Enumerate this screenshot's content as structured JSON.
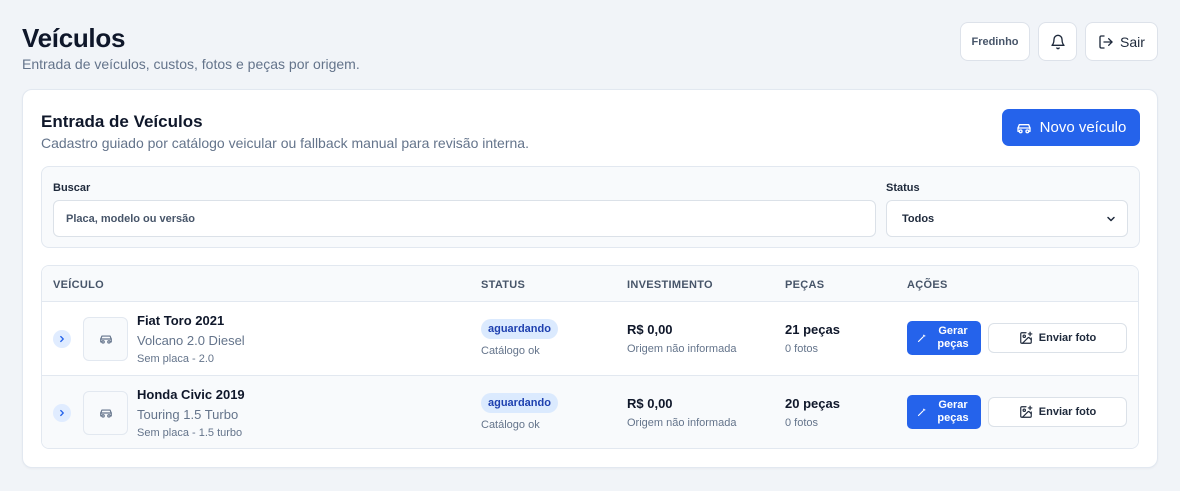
{
  "page": {
    "title": "Veículos",
    "subtitle": "Entrada de veículos, custos, fotos e peças por origem."
  },
  "header": {
    "user_label": "Fredinho",
    "logout_label": "Sair"
  },
  "card": {
    "title": "Entrada de Veículos",
    "subtitle": "Cadastro guiado por catálogo veicular ou fallback manual para revisão interna.",
    "new_button_label": "Novo veículo"
  },
  "filters": {
    "search_label": "Buscar",
    "search_placeholder": "Placa, modelo ou versão",
    "status_label": "Status",
    "status_selected": "Todos"
  },
  "table": {
    "columns": [
      "VEÍCULO",
      "STATUS",
      "INVESTIMENTO",
      "PEÇAS",
      "AÇÕES"
    ],
    "rows": [
      {
        "name": "Fiat Toro 2021",
        "version": "Volcano 2.0 Diesel",
        "plate": "Sem placa - 2.0",
        "status": "aguardando",
        "catalog": "Catálogo ok",
        "investment": "R$ 0,00",
        "origin": "Origem não informada",
        "parts": "21 peças",
        "photos": "0 fotos",
        "generate_label": "Gerar peças",
        "upload_label": "Enviar foto"
      },
      {
        "name": "Honda Civic 2019",
        "version": "Touring 1.5 Turbo",
        "plate": "Sem placa - 1.5 turbo",
        "status": "aguardando",
        "catalog": "Catálogo ok",
        "investment": "R$ 0,00",
        "origin": "Origem não informada",
        "parts": "20 peças",
        "photos": "0 fotos",
        "generate_label": "Gerar peças",
        "upload_label": "Enviar foto"
      }
    ]
  },
  "icons": {
    "bell": "bell-icon",
    "logout": "logout-icon",
    "car": "car-icon",
    "chevron_right": "chevron-right-icon",
    "chevron_down": "chevron-down-icon",
    "wand": "wand-icon",
    "image_plus": "image-plus-icon"
  },
  "colors": {
    "primary": "#2563eb",
    "badge_bg": "#dbeafe",
    "badge_text": "#1e40af",
    "background": "#f1f4f8"
  }
}
